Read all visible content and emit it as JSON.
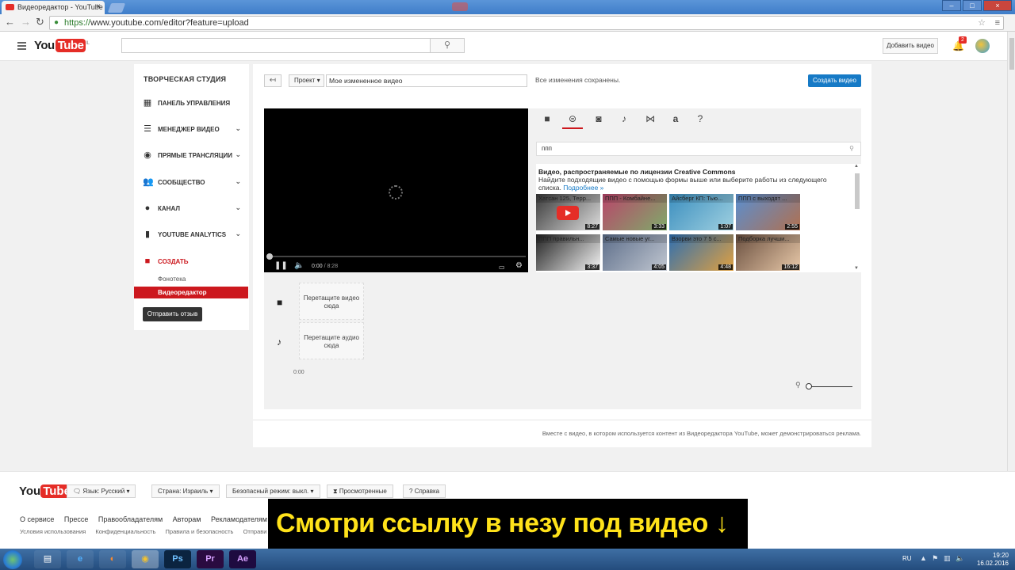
{
  "browser": {
    "tab_title": "Видеоредактор - YouTube",
    "url_scheme": "https://",
    "url_rest": "www.youtube.com/editor?feature=upload"
  },
  "header": {
    "logo_you": "You",
    "logo_tube": "Tube",
    "logo_region": "IL",
    "upload_label": "Добавить видео",
    "notification_count": "2"
  },
  "sidebar": {
    "title": "ТВОРЧЕСКАЯ СТУДИЯ",
    "items": [
      {
        "label": "ПАНЕЛЬ УПРАВЛЕНИЯ",
        "icon": "dashboard-icon"
      },
      {
        "label": "МЕНЕДЖЕР ВИДЕО",
        "icon": "video-manager-icon"
      },
      {
        "label": "ПРЯМЫЕ ТРАНСЛЯЦИИ",
        "icon": "live-icon"
      },
      {
        "label": "СООБЩЕСТВО",
        "icon": "community-icon"
      },
      {
        "label": "КАНАЛ",
        "icon": "channel-icon"
      },
      {
        "label": "YOUTUBE ANALYTICS",
        "icon": "analytics-icon"
      },
      {
        "label": "СОЗДАТЬ",
        "icon": "create-icon"
      }
    ],
    "sub_items": [
      "Фонотека",
      "Видеоредактор"
    ],
    "feedback_label": "Отправить отзыв"
  },
  "editor": {
    "project_label": "Проект",
    "title_value": "Мое измененное видео",
    "saved_status": "Все изменения сохранены.",
    "create_label": "Создать видео",
    "player": {
      "current": "0:00",
      "duration": "/ 8:28"
    },
    "search_value": "ппп",
    "library_heading": "Видео, распространяемые по лицензии Creative Commons",
    "library_desc": "Найдите подходящие видео с помощью формы выше или выберите работы из следующего списка.",
    "library_more": "Подробнее »",
    "thumbnails": [
      {
        "title": "Хатсан 125, Терр...",
        "duration": "8:27",
        "colors": [
          "#3a3a3a",
          "#ddd"
        ]
      },
      {
        "title": "ППП - Комбайне...",
        "duration": "3:33",
        "colors": [
          "#b9456a",
          "#7faa6a"
        ]
      },
      {
        "title": "Айсберг КП: Тью...",
        "duration": "1:07",
        "colors": [
          "#3c8fbf",
          "#9fd0e0"
        ]
      },
      {
        "title": "ППП с выходят ...",
        "duration": "2:55",
        "colors": [
          "#5a8fd0",
          "#b07050"
        ]
      },
      {
        "title": "ППП правильн...",
        "duration": "3:37",
        "colors": [
          "#222",
          "#f4f4f4"
        ]
      },
      {
        "title": "Самые новые уг...",
        "duration": "4:05",
        "colors": [
          "#5d6e8a",
          "#c0c6d0"
        ]
      },
      {
        "title": "Взорви это 7 5 с...",
        "duration": "4:48",
        "colors": [
          "#2f6fb0",
          "#e0a040"
        ]
      },
      {
        "title": "Подборка лучши...",
        "duration": "16:12",
        "colors": [
          "#6a5040",
          "#e8c8a8"
        ]
      }
    ],
    "video_drop": "Перетащите видео сюда",
    "audio_drop": "Перетащите аудио сюда",
    "timeline_start": "0:00",
    "footer_note": "Вместе с видео, в котором используется контент из Видеоредактора YouTube, может демонстрироваться реклама."
  },
  "footer": {
    "logo_you": "You",
    "logo_tube": "Tube",
    "language": "Язык: Русский",
    "country": "Страна: Израиль",
    "safe_mode": "Безопасный режим: выкл.",
    "history": "Просмотренные",
    "help": "Справка",
    "links": [
      "О сервисе",
      "Прессе",
      "Правообладателям",
      "Авторам",
      "Рекламодателям"
    ],
    "links2": [
      "Условия использования",
      "Конфиденциальность",
      "Правила и безопасность",
      "Отправи"
    ]
  },
  "overlay_text": "Смотри ссылку в незу под видео ↓",
  "taskbar": {
    "lang": "RU",
    "time": "19:20",
    "date": "16.02.2016",
    "apps": [
      "Ps",
      "Pr",
      "Ae"
    ]
  }
}
